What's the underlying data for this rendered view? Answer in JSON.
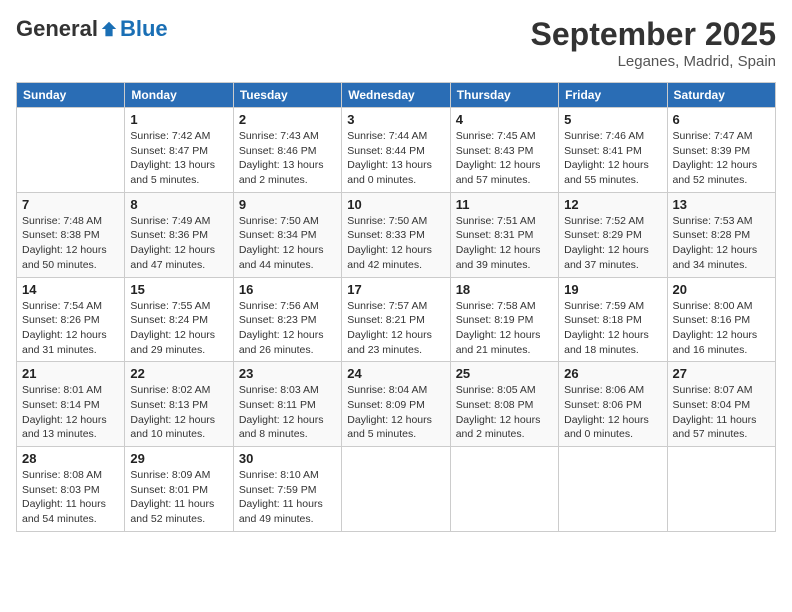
{
  "header": {
    "logo": {
      "general": "General",
      "blue": "Blue"
    },
    "title": "September 2025",
    "subtitle": "Leganes, Madrid, Spain"
  },
  "days_of_week": [
    "Sunday",
    "Monday",
    "Tuesday",
    "Wednesday",
    "Thursday",
    "Friday",
    "Saturday"
  ],
  "weeks": [
    [
      {
        "day": "",
        "info": ""
      },
      {
        "day": "1",
        "info": "Sunrise: 7:42 AM\nSunset: 8:47 PM\nDaylight: 13 hours\nand 5 minutes."
      },
      {
        "day": "2",
        "info": "Sunrise: 7:43 AM\nSunset: 8:46 PM\nDaylight: 13 hours\nand 2 minutes."
      },
      {
        "day": "3",
        "info": "Sunrise: 7:44 AM\nSunset: 8:44 PM\nDaylight: 13 hours\nand 0 minutes."
      },
      {
        "day": "4",
        "info": "Sunrise: 7:45 AM\nSunset: 8:43 PM\nDaylight: 12 hours\nand 57 minutes."
      },
      {
        "day": "5",
        "info": "Sunrise: 7:46 AM\nSunset: 8:41 PM\nDaylight: 12 hours\nand 55 minutes."
      },
      {
        "day": "6",
        "info": "Sunrise: 7:47 AM\nSunset: 8:39 PM\nDaylight: 12 hours\nand 52 minutes."
      }
    ],
    [
      {
        "day": "7",
        "info": "Sunrise: 7:48 AM\nSunset: 8:38 PM\nDaylight: 12 hours\nand 50 minutes."
      },
      {
        "day": "8",
        "info": "Sunrise: 7:49 AM\nSunset: 8:36 PM\nDaylight: 12 hours\nand 47 minutes."
      },
      {
        "day": "9",
        "info": "Sunrise: 7:50 AM\nSunset: 8:34 PM\nDaylight: 12 hours\nand 44 minutes."
      },
      {
        "day": "10",
        "info": "Sunrise: 7:50 AM\nSunset: 8:33 PM\nDaylight: 12 hours\nand 42 minutes."
      },
      {
        "day": "11",
        "info": "Sunrise: 7:51 AM\nSunset: 8:31 PM\nDaylight: 12 hours\nand 39 minutes."
      },
      {
        "day": "12",
        "info": "Sunrise: 7:52 AM\nSunset: 8:29 PM\nDaylight: 12 hours\nand 37 minutes."
      },
      {
        "day": "13",
        "info": "Sunrise: 7:53 AM\nSunset: 8:28 PM\nDaylight: 12 hours\nand 34 minutes."
      }
    ],
    [
      {
        "day": "14",
        "info": "Sunrise: 7:54 AM\nSunset: 8:26 PM\nDaylight: 12 hours\nand 31 minutes."
      },
      {
        "day": "15",
        "info": "Sunrise: 7:55 AM\nSunset: 8:24 PM\nDaylight: 12 hours\nand 29 minutes."
      },
      {
        "day": "16",
        "info": "Sunrise: 7:56 AM\nSunset: 8:23 PM\nDaylight: 12 hours\nand 26 minutes."
      },
      {
        "day": "17",
        "info": "Sunrise: 7:57 AM\nSunset: 8:21 PM\nDaylight: 12 hours\nand 23 minutes."
      },
      {
        "day": "18",
        "info": "Sunrise: 7:58 AM\nSunset: 8:19 PM\nDaylight: 12 hours\nand 21 minutes."
      },
      {
        "day": "19",
        "info": "Sunrise: 7:59 AM\nSunset: 8:18 PM\nDaylight: 12 hours\nand 18 minutes."
      },
      {
        "day": "20",
        "info": "Sunrise: 8:00 AM\nSunset: 8:16 PM\nDaylight: 12 hours\nand 16 minutes."
      }
    ],
    [
      {
        "day": "21",
        "info": "Sunrise: 8:01 AM\nSunset: 8:14 PM\nDaylight: 12 hours\nand 13 minutes."
      },
      {
        "day": "22",
        "info": "Sunrise: 8:02 AM\nSunset: 8:13 PM\nDaylight: 12 hours\nand 10 minutes."
      },
      {
        "day": "23",
        "info": "Sunrise: 8:03 AM\nSunset: 8:11 PM\nDaylight: 12 hours\nand 8 minutes."
      },
      {
        "day": "24",
        "info": "Sunrise: 8:04 AM\nSunset: 8:09 PM\nDaylight: 12 hours\nand 5 minutes."
      },
      {
        "day": "25",
        "info": "Sunrise: 8:05 AM\nSunset: 8:08 PM\nDaylight: 12 hours\nand 2 minutes."
      },
      {
        "day": "26",
        "info": "Sunrise: 8:06 AM\nSunset: 8:06 PM\nDaylight: 12 hours\nand 0 minutes."
      },
      {
        "day": "27",
        "info": "Sunrise: 8:07 AM\nSunset: 8:04 PM\nDaylight: 11 hours\nand 57 minutes."
      }
    ],
    [
      {
        "day": "28",
        "info": "Sunrise: 8:08 AM\nSunset: 8:03 PM\nDaylight: 11 hours\nand 54 minutes."
      },
      {
        "day": "29",
        "info": "Sunrise: 8:09 AM\nSunset: 8:01 PM\nDaylight: 11 hours\nand 52 minutes."
      },
      {
        "day": "30",
        "info": "Sunrise: 8:10 AM\nSunset: 7:59 PM\nDaylight: 11 hours\nand 49 minutes."
      },
      {
        "day": "",
        "info": ""
      },
      {
        "day": "",
        "info": ""
      },
      {
        "day": "",
        "info": ""
      },
      {
        "day": "",
        "info": ""
      }
    ]
  ]
}
